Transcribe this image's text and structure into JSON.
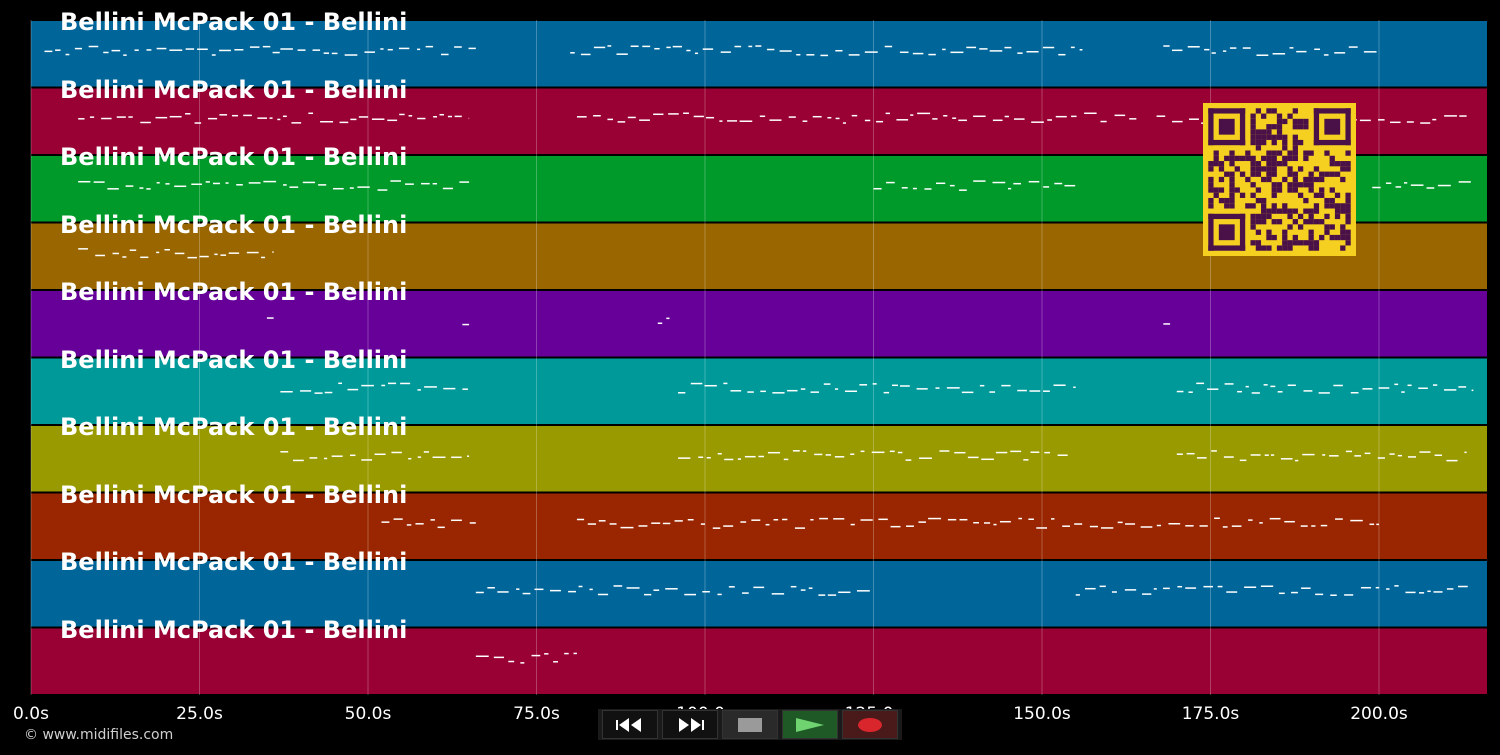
{
  "tracks": [
    {
      "label": "Bellini McPack 01 - Bellini",
      "color": "#00669a"
    },
    {
      "label": "Bellini McPack 01 - Bellini",
      "color": "#990033"
    },
    {
      "label": "Bellini McPack 01 - Bellini",
      "color": "#009a2a"
    },
    {
      "label": "Bellini McPack 01 - Bellini",
      "color": "#996600"
    },
    {
      "label": "Bellini McPack 01 - Bellini",
      "color": "#660099"
    },
    {
      "label": "Bellini McPack 01 - Bellini",
      "color": "#009999"
    },
    {
      "label": "Bellini McPack 01 - Bellini",
      "color": "#999900"
    },
    {
      "label": "Bellini McPack 01 - Bellini",
      "color": "#992600"
    },
    {
      "label": "Bellini McPack 01 - Bellini",
      "color": "#00669a"
    },
    {
      "label": "Bellini McPack 01 - Bellini",
      "color": "#990033"
    }
  ],
  "time_axis": {
    "ticks": [
      "0.0s",
      "25.0s",
      "50.0s",
      "75.0s",
      "100.0s",
      "125.0s",
      "150.0s",
      "175.0s",
      "200.0s"
    ],
    "tick_values": [
      0,
      25,
      50,
      75,
      100,
      125,
      150,
      175,
      200
    ],
    "max_seconds": 216
  },
  "note_spans": [
    [
      [
        2,
        37
      ],
      [
        37,
        66
      ],
      [
        80,
        156
      ],
      [
        168,
        200
      ]
    ],
    [
      [
        7,
        65
      ],
      [
        81,
        164
      ],
      [
        167,
        213
      ]
    ],
    [
      [
        7,
        65
      ],
      [
        125,
        155
      ],
      [
        199,
        214
      ]
    ],
    [
      [
        7,
        36
      ]
    ],
    [
      [
        35,
        36
      ],
      [
        64,
        65
      ],
      [
        93,
        95
      ],
      [
        168,
        169
      ]
    ],
    [
      [
        37,
        65
      ],
      [
        96,
        155
      ],
      [
        170,
        214
      ]
    ],
    [
      [
        37,
        65
      ],
      [
        96,
        154
      ],
      [
        170,
        213
      ]
    ],
    [
      [
        52,
        66
      ],
      [
        81,
        200
      ]
    ],
    [
      [
        66,
        125
      ],
      [
        155,
        214
      ]
    ],
    [
      [
        66,
        81
      ]
    ]
  ],
  "transport": {
    "buttons": [
      {
        "name": "rewind",
        "icon": "rewind-icon"
      },
      {
        "name": "fast-forward",
        "icon": "fast-forward-icon"
      },
      {
        "name": "stop",
        "icon": "stop-icon"
      },
      {
        "name": "play",
        "icon": "play-icon"
      },
      {
        "name": "record",
        "icon": "record-icon"
      }
    ]
  },
  "qr_icon": "qr-code-icon",
  "copyright": "© www.midifiles.com"
}
